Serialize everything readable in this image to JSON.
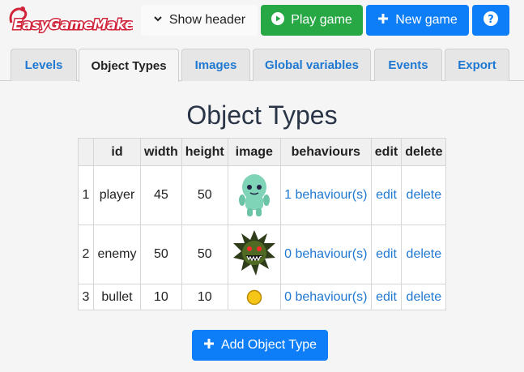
{
  "header": {
    "logo_text": "EasyGameMaker",
    "show_header_label": "Show header",
    "play_game_label": "Play game",
    "new_game_label": "New game",
    "help_label": "?"
  },
  "tabs": [
    {
      "label": "Levels"
    },
    {
      "label": "Object Types",
      "active": true
    },
    {
      "label": "Images"
    },
    {
      "label": "Global variables"
    },
    {
      "label": "Events"
    },
    {
      "label": "Export"
    }
  ],
  "main": {
    "title": "Object Types",
    "columns": [
      "",
      "id",
      "width",
      "height",
      "image",
      "behaviours",
      "edit",
      "delete"
    ],
    "rows": [
      {
        "index": "1",
        "id": "player",
        "width": "45",
        "height": "50",
        "image": "ghost-sprite-icon",
        "behaviours": "1 behaviour(s)",
        "edit": "edit",
        "delete": "delete"
      },
      {
        "index": "2",
        "id": "enemy",
        "width": "50",
        "height": "50",
        "image": "spiky-monster-sprite-icon",
        "behaviours": "0 behaviour(s)",
        "edit": "edit",
        "delete": "delete"
      },
      {
        "index": "3",
        "id": "bullet",
        "width": "10",
        "height": "10",
        "image": "coin-sprite-icon",
        "behaviours": "0 behaviour(s)",
        "edit": "edit",
        "delete": "delete"
      }
    ],
    "add_button_label": "Add Object Type"
  },
  "colors": {
    "primary": "#0d7ef7",
    "success": "#28a745",
    "link": "#1f78d1"
  }
}
